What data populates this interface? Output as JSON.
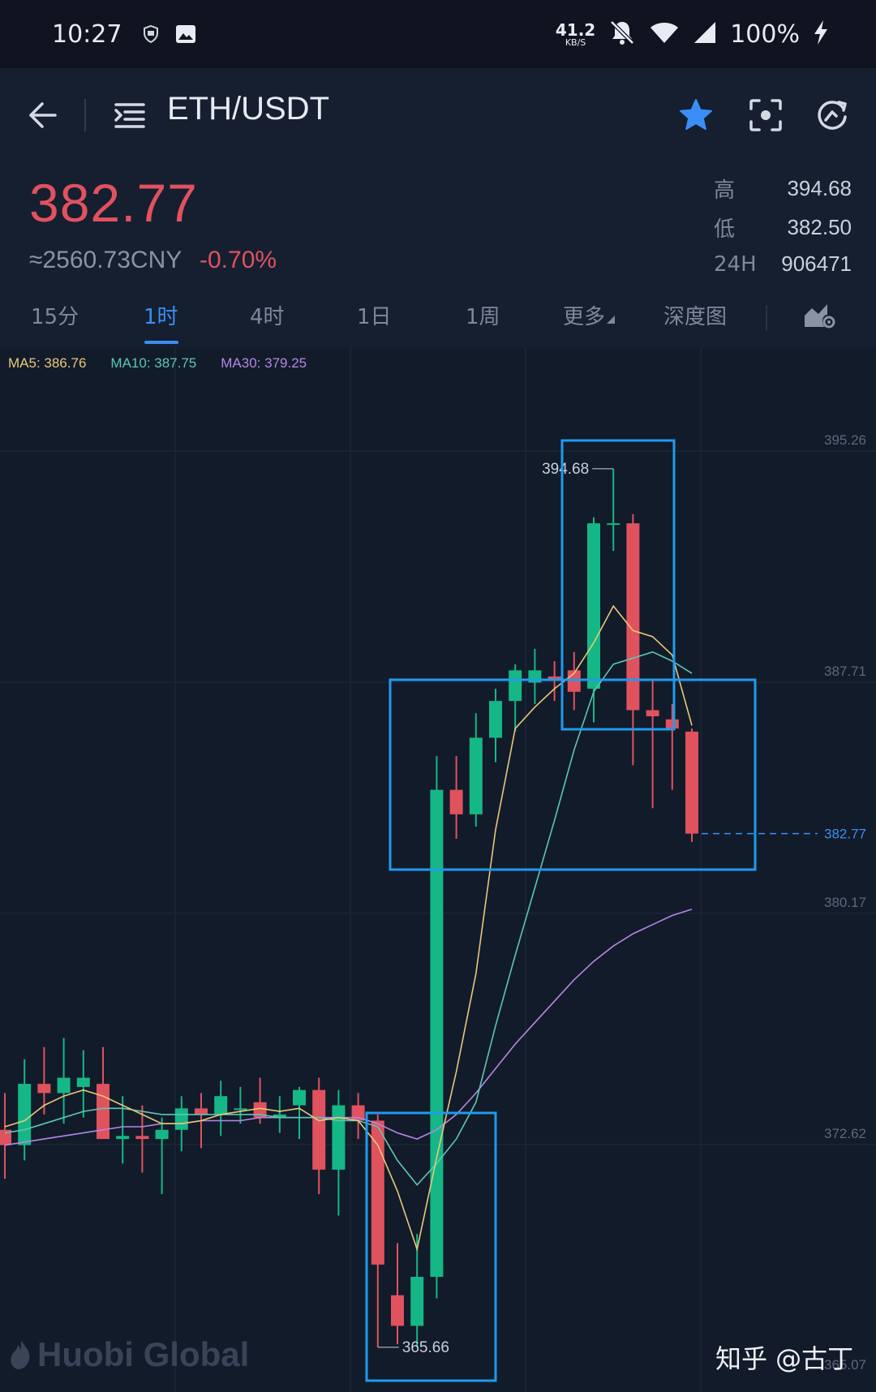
{
  "status_bar": {
    "time": "10:27",
    "net_speed": "41.2",
    "net_unit": "KB/S",
    "battery": "100%"
  },
  "header": {
    "pair": "ETH/USDT"
  },
  "price": {
    "last": "382.77",
    "cny": "≈2560.73CNY",
    "change": "-0.70%",
    "high_label": "高",
    "high": "394.68",
    "low_label": "低",
    "low": "382.50",
    "vol_label": "24H",
    "vol": "906471"
  },
  "tabs": [
    {
      "label": "15分"
    },
    {
      "label": "1时"
    },
    {
      "label": "4时"
    },
    {
      "label": "1日"
    },
    {
      "label": "1周"
    },
    {
      "label": "更多"
    },
    {
      "label": "深度图"
    }
  ],
  "indicators": {
    "ma5": "MA5: 386.76",
    "ma10": "MA10: 387.75",
    "ma30": "MA30: 379.25"
  },
  "colors": {
    "up": "#16b786",
    "down": "#e0525e",
    "ma5": "#e8c878",
    "ma10": "#5cc7b0",
    "ma30": "#b487e6",
    "accent": "#3a8ef5",
    "box": "#1f9bef"
  },
  "watermark": "Huobi Global",
  "credit": "知乎 @古丁",
  "chart_data": {
    "type": "candlestick",
    "y_ticks": [
      "395.26",
      "387.71",
      "380.17",
      "372.62",
      "365.07"
    ],
    "ylim": [
      365.07,
      395.26
    ],
    "current_price_label": "382.77",
    "high_label": "394.68",
    "low_label": "365.66",
    "candles": [
      {
        "o": 373.1,
        "h": 374.3,
        "l": 371.5,
        "c": 372.6
      },
      {
        "o": 372.6,
        "h": 375.4,
        "l": 372.1,
        "c": 374.6
      },
      {
        "o": 374.6,
        "h": 375.8,
        "l": 373.6,
        "c": 374.3
      },
      {
        "o": 374.3,
        "h": 376.1,
        "l": 373.3,
        "c": 374.8
      },
      {
        "o": 374.5,
        "h": 375.7,
        "l": 373.5,
        "c": 374.8
      },
      {
        "o": 374.6,
        "h": 375.8,
        "l": 373.0,
        "c": 372.8
      },
      {
        "o": 372.8,
        "h": 374.2,
        "l": 372.0,
        "c": 372.9
      },
      {
        "o": 372.9,
        "h": 373.9,
        "l": 371.7,
        "c": 372.8
      },
      {
        "o": 372.8,
        "h": 373.5,
        "l": 371.0,
        "c": 373.1
      },
      {
        "o": 373.1,
        "h": 374.2,
        "l": 372.4,
        "c": 373.8
      },
      {
        "o": 373.8,
        "h": 374.3,
        "l": 372.5,
        "c": 373.6
      },
      {
        "o": 373.6,
        "h": 374.7,
        "l": 372.9,
        "c": 374.2
      },
      {
        "o": 373.8,
        "h": 374.5,
        "l": 373.3,
        "c": 373.8
      },
      {
        "o": 374.0,
        "h": 374.8,
        "l": 373.3,
        "c": 373.5
      },
      {
        "o": 373.5,
        "h": 374.2,
        "l": 373.0,
        "c": 373.6
      },
      {
        "o": 373.9,
        "h": 374.5,
        "l": 372.8,
        "c": 374.4
      },
      {
        "o": 374.4,
        "h": 374.8,
        "l": 371.0,
        "c": 371.8
      },
      {
        "o": 371.8,
        "h": 374.4,
        "l": 370.3,
        "c": 373.9
      },
      {
        "o": 373.9,
        "h": 374.3,
        "l": 372.8,
        "c": 373.4
      },
      {
        "o": 373.4,
        "h": 373.6,
        "l": 366.0,
        "c": 368.7
      },
      {
        "o": 367.7,
        "h": 369.4,
        "l": 366.1,
        "c": 366.7
      },
      {
        "o": 366.7,
        "h": 369.7,
        "l": 366.0,
        "c": 368.3
      },
      {
        "o": 368.3,
        "h": 385.3,
        "l": 367.6,
        "c": 384.2
      },
      {
        "o": 384.2,
        "h": 385.3,
        "l": 382.6,
        "c": 383.4
      },
      {
        "o": 383.4,
        "h": 386.7,
        "l": 383.0,
        "c": 385.9
      },
      {
        "o": 385.9,
        "h": 387.5,
        "l": 385.1,
        "c": 387.1
      },
      {
        "o": 387.1,
        "h": 388.3,
        "l": 386.1,
        "c": 388.1
      },
      {
        "o": 387.7,
        "h": 388.8,
        "l": 387.0,
        "c": 388.1
      },
      {
        "o": 387.9,
        "h": 388.4,
        "l": 387.1,
        "c": 387.8
      },
      {
        "o": 388.1,
        "h": 388.7,
        "l": 386.8,
        "c": 387.4
      },
      {
        "o": 387.5,
        "h": 393.1,
        "l": 386.4,
        "c": 392.9
      },
      {
        "o": 392.9,
        "h": 394.68,
        "l": 392.0,
        "c": 392.9
      },
      {
        "o": 392.9,
        "h": 393.2,
        "l": 385.0,
        "c": 386.8
      },
      {
        "o": 386.8,
        "h": 387.8,
        "l": 383.6,
        "c": 386.6
      },
      {
        "o": 386.5,
        "h": 387.0,
        "l": 384.2,
        "c": 386.2
      },
      {
        "o": 386.1,
        "h": 386.2,
        "l": 382.5,
        "c": 382.77
      }
    ],
    "ma5": [
      373.2,
      373.4,
      373.9,
      374.2,
      374.4,
      374.2,
      373.9,
      373.6,
      373.3,
      373.3,
      373.4,
      373.6,
      373.7,
      373.8,
      373.7,
      373.8,
      373.4,
      373.5,
      373.4,
      372.6,
      371.1,
      369.2,
      372.2,
      375.0,
      378.2,
      382.9,
      386.2,
      386.9,
      387.5,
      388.0,
      389.0,
      390.2,
      389.4,
      389.2,
      388.6,
      386.3
    ],
    "ma10": [
      373.0,
      373.1,
      373.3,
      373.5,
      373.7,
      373.8,
      373.8,
      373.7,
      373.6,
      373.6,
      373.6,
      373.6,
      373.6,
      373.6,
      373.5,
      373.5,
      373.5,
      373.4,
      373.4,
      373.2,
      372.1,
      371.3,
      372.0,
      372.8,
      374.0,
      376.5,
      378.8,
      381.0,
      383.2,
      385.5,
      387.4,
      388.3,
      388.5,
      388.7,
      388.4,
      388.0
    ],
    "ma30": [
      372.6,
      372.7,
      372.8,
      372.9,
      373.0,
      373.1,
      373.2,
      373.2,
      373.3,
      373.3,
      373.4,
      373.4,
      373.4,
      373.5,
      373.5,
      373.5,
      373.5,
      373.5,
      373.5,
      373.3,
      373.0,
      372.8,
      373.1,
      373.6,
      374.3,
      375.1,
      375.9,
      376.6,
      377.3,
      378.0,
      378.6,
      379.1,
      379.5,
      379.8,
      380.1,
      380.3
    ]
  }
}
